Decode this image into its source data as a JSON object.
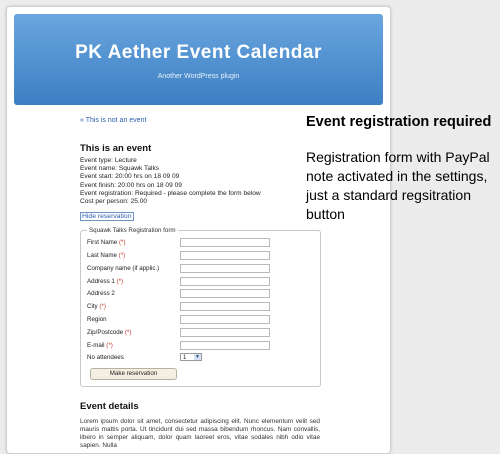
{
  "header": {
    "title": "PK Aether Event Calendar",
    "tagline": "Another WordPress plugin"
  },
  "event": {
    "back_link": "« This is not an event",
    "title": "This is an event",
    "meta": [
      "Event type: Lecture",
      "Event name: Squawk Talks",
      "Event start: 20:00 hrs on 18 09 09",
      "Event finish: 20:00 hrs on 18 09 09",
      "Event registration: Required - please complete the form below",
      "Cost per person: 25.00"
    ],
    "hide_link": "Hide reservation"
  },
  "form": {
    "legend": "Squawk Talks Registration form",
    "fields": [
      {
        "label": "First Name",
        "req": " (*)"
      },
      {
        "label": "Last Name",
        "req": " (*)"
      },
      {
        "label": "Company name (if applic.)",
        "req": ""
      },
      {
        "label": "Address 1",
        "req": " (*)"
      },
      {
        "label": "Address 2",
        "req": ""
      },
      {
        "label": "City",
        "req": " (*)"
      },
      {
        "label": "Region",
        "req": ""
      },
      {
        "label": "Zip/Postcode",
        "req": " (*)"
      },
      {
        "label": "E-mail",
        "req": " (*)"
      }
    ],
    "attendees_label": "No attendees",
    "attendees_value": "1",
    "submit_label": "Make reservation"
  },
  "details": {
    "title": "Event details",
    "text": "Lorem ipsum dolor sit amet, consectetur adipiscing elit. Nunc elementum velit sed mauris mattis porta. Ut tincidunt dui sed massa bibendum rhoncus. Nam convallis, libero in semper aliquam, dolor quam laoreet eros, vitae sodales nibh odio vitae sapien. Nulla"
  },
  "annotation": {
    "heading": "Event registration required",
    "body": "Registration form with PayPal note activated in the settings, just a standard regsitration button"
  },
  "colors": {
    "header_top": "#6aa6df",
    "header_bottom": "#3d7fc3",
    "link": "#2a5db0",
    "required": "#c0392b"
  }
}
